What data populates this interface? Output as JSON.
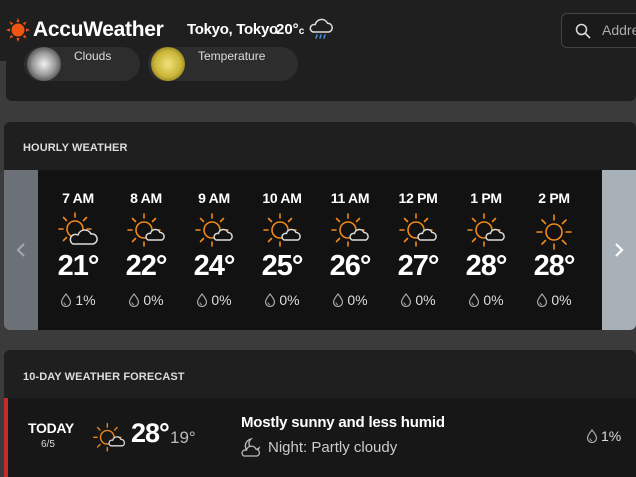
{
  "header": {
    "brand": "AccuWeather",
    "location": "Tokyo, Tokyo",
    "temp": "20°",
    "unit": "c",
    "current_icon": "rain-cloud-icon",
    "search": {
      "placeholder": "Address"
    }
  },
  "top_card": {
    "pills": [
      {
        "label": "Clouds",
        "icon": "clouds-photo"
      },
      {
        "label": "Temperature",
        "icon": "temperature-photo"
      }
    ]
  },
  "hourly": {
    "title": "HOURLY WEATHER",
    "hours": [
      {
        "time": "7 AM",
        "temp": "21°",
        "precip": "1%",
        "icon": "partly-cloudy-icon"
      },
      {
        "time": "8 AM",
        "temp": "22°",
        "precip": "0%",
        "icon": "mostly-sunny-icon"
      },
      {
        "time": "9 AM",
        "temp": "24°",
        "precip": "0%",
        "icon": "mostly-sunny-icon"
      },
      {
        "time": "10 AM",
        "temp": "25°",
        "precip": "0%",
        "icon": "mostly-sunny-icon"
      },
      {
        "time": "11 AM",
        "temp": "26°",
        "precip": "0%",
        "icon": "mostly-sunny-icon"
      },
      {
        "time": "12 PM",
        "temp": "27°",
        "precip": "0%",
        "icon": "mostly-sunny-icon"
      },
      {
        "time": "1 PM",
        "temp": "28°",
        "precip": "0%",
        "icon": "mostly-sunny-icon"
      },
      {
        "time": "2 PM",
        "temp": "28°",
        "precip": "0%",
        "icon": "sunny-icon"
      }
    ]
  },
  "forecast": {
    "title": "10-DAY WEATHER FORECAST",
    "days": [
      {
        "day": "TODAY",
        "date": "6/5",
        "hi": "28°",
        "lo": "19°",
        "phrase": "Mostly sunny and less humid",
        "night": "Night: Partly cloudy",
        "precip": "1%",
        "icon": "mostly-sunny-icon"
      }
    ]
  },
  "colors": {
    "accent": "#f05514",
    "sun": "#f3891a",
    "today_marker": "#c62a2a"
  }
}
